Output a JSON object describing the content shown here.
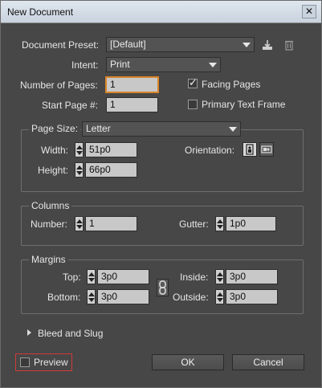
{
  "window": {
    "title": "New Document",
    "close_glyph": "✕"
  },
  "document_preset": {
    "label": "Document Preset:",
    "value": "[Default]"
  },
  "intent": {
    "label": "Intent:",
    "value": "Print"
  },
  "number_of_pages": {
    "label": "Number of Pages:",
    "value": "1"
  },
  "start_page": {
    "label": "Start Page #:",
    "value": "1"
  },
  "facing_pages": {
    "label": "Facing Pages",
    "checked": true
  },
  "primary_text_frame": {
    "label": "Primary Text Frame",
    "checked": false
  },
  "page_size": {
    "label": "Page Size:",
    "value": "Letter",
    "width_label": "Width:",
    "width_value": "51p0",
    "height_label": "Height:",
    "height_value": "66p0",
    "orientation_label": "Orientation:",
    "orientation_selected": "portrait"
  },
  "columns": {
    "title": "Columns",
    "number_label": "Number:",
    "number_value": "1",
    "gutter_label": "Gutter:",
    "gutter_value": "1p0"
  },
  "margins": {
    "title": "Margins",
    "top_label": "Top:",
    "top_value": "3p0",
    "bottom_label": "Bottom:",
    "bottom_value": "3p0",
    "inside_label": "Inside:",
    "inside_value": "3p0",
    "outside_label": "Outside:",
    "outside_value": "3p0"
  },
  "bleed_and_slug": {
    "label": "Bleed and Slug"
  },
  "preview": {
    "label": "Preview",
    "checked": false
  },
  "buttons": {
    "ok": "OK",
    "cancel": "Cancel"
  },
  "colors": {
    "focus_border": "#d9852a",
    "highlight_box": "#d23a3a"
  }
}
